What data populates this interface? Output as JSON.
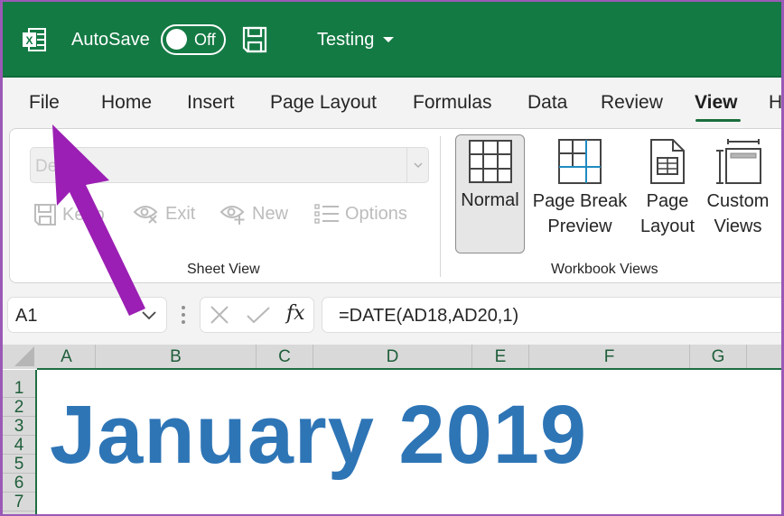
{
  "titlebar": {
    "app_icon": "excel-icon",
    "autosave_label": "AutoSave",
    "autosave_state": "Off",
    "save_icon": "save-icon",
    "document_title": "Testing"
  },
  "tabs": [
    {
      "label": "File"
    },
    {
      "label": "Home"
    },
    {
      "label": "Insert"
    },
    {
      "label": "Page Layout"
    },
    {
      "label": "Formulas"
    },
    {
      "label": "Data"
    },
    {
      "label": "Review"
    },
    {
      "label": "View",
      "active": true
    },
    {
      "label": "H"
    }
  ],
  "ribbon": {
    "sheet_view": {
      "dropdown_value": "De",
      "buttons": [
        {
          "label": "Keep",
          "icon": "save-icon"
        },
        {
          "label": "Exit",
          "icon": "eye-x-icon"
        },
        {
          "label": "New",
          "icon": "eye-plus-icon"
        },
        {
          "label": "Options",
          "icon": "list-icon"
        }
      ],
      "group_label": "Sheet View"
    },
    "workbook_views": {
      "buttons": [
        {
          "label": "Normal",
          "icon": "grid-icon",
          "selected": true
        },
        {
          "label": "Page Break\nPreview",
          "line1": "Page Break",
          "line2": "Preview",
          "icon": "page-break-icon"
        },
        {
          "label": "Page\nLayout",
          "line1": "Page",
          "line2": "Layout",
          "icon": "page-layout-icon"
        },
        {
          "label": "Custom\nViews",
          "line1": "Custom",
          "line2": "Views",
          "icon": "custom-views-icon"
        }
      ],
      "group_label": "Workbook Views"
    }
  },
  "formula_bar": {
    "name_box": "A1",
    "cancel_icon": "close-icon",
    "enter_icon": "check-icon",
    "fx_label": "fx",
    "formula": "=DATE(AD18,AD20,1)"
  },
  "grid": {
    "columns": [
      "A",
      "B",
      "C",
      "D",
      "E",
      "F",
      "G"
    ],
    "rows": [
      "1",
      "2",
      "3",
      "4",
      "5",
      "6",
      "7"
    ],
    "cell_display": "January 2019",
    "cell_text_color": "#2e75b6"
  },
  "colors": {
    "titlebar": "#147a44",
    "accent": "#1f6e43",
    "annotation_arrow": "#9b1fb4"
  }
}
